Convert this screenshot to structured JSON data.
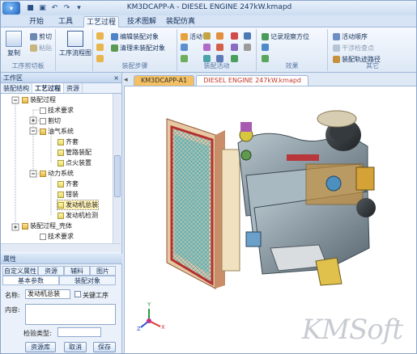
{
  "window": {
    "title": "KM3DCAPP-A - DIESEL ENGINE 247kW.kmapd"
  },
  "menu_tabs": [
    "开始",
    "工具",
    "工艺过程",
    "技术图解",
    "装配仿真"
  ],
  "ribbon": {
    "clipboard": {
      "label": "工序剪切板",
      "copy": "复制",
      "cut": "剪切",
      "paste": "粘贴"
    },
    "flow": {
      "label": "工序流程图"
    },
    "steps": {
      "label": "装配步骤",
      "edit": "编辑装配对象",
      "clear": "清理未装配对象"
    },
    "activities": {
      "label": "装配活动",
      "item1": "活动"
    },
    "effects": {
      "label": "效果",
      "record": "记录观察方位"
    },
    "other": {
      "label": "其它",
      "seq": "活动顺序",
      "interference": "干涉检查点",
      "path": "装配轨迹路径"
    }
  },
  "workspace": {
    "title": "工作区",
    "close": "×",
    "tabs": [
      "装配结构",
      "工艺过程",
      "资源"
    ],
    "tree": [
      "装配过程",
      "技术要求",
      "割切",
      "油气系统",
      "齐套",
      "管路装配",
      "点火装置",
      "动力系统",
      "齐套",
      "钳装",
      "发动机总装",
      "发动机检测",
      "装配过程_壳体",
      "技术要求"
    ]
  },
  "properties": {
    "title": "属性",
    "tabs_row1": [
      "自定义属性",
      "资源",
      "辅料",
      "图片"
    ],
    "tabs_row2": [
      "基本参数",
      "装配对象"
    ],
    "name_label": "名称:",
    "name_value": "发动机总装",
    "key_proc": "关键工序",
    "content_label": "内容:",
    "inspect_label": "检验类型:",
    "btn_resource": "资源库",
    "btn_cancel": "取消",
    "btn_save": "保存"
  },
  "documents": {
    "tabs": [
      "KM3DCAPP-A1",
      "DIESEL ENGINE 247kW.kmapd"
    ]
  },
  "watermark": "KMSoft"
}
